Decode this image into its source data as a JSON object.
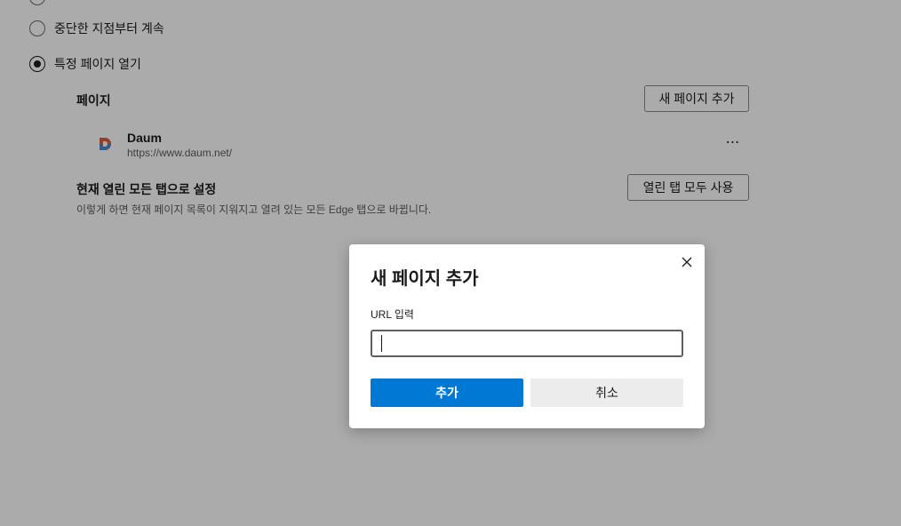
{
  "startup": {
    "options": [
      {
        "label": "중단한 지점부터 계속",
        "checked": false
      },
      {
        "label": "특정 페이지 열기",
        "checked": true
      }
    ],
    "pages_label": "페이지",
    "add_page_button": "새 페이지 추가",
    "sites": [
      {
        "name": "Daum",
        "url": "https://www.daum.net/",
        "icon": "daum-logo-icon",
        "more_label": "⋯"
      }
    ],
    "use_open_tabs": {
      "title": "현재 열린 모든 탭으로 설정",
      "description": "이렇게 하면 현재 페이지 목록이 지워지고 열려 있는 모든 Edge 탭으로 바뀝니다.",
      "button": "열린 탭 모두 사용"
    }
  },
  "dialog": {
    "title": "새 페이지 추가",
    "field_label": "URL 입력",
    "url_value": "",
    "primary_button": "추가",
    "secondary_button": "취소",
    "close_icon": "close-icon"
  },
  "colors": {
    "accent": "#0078d4",
    "overlay": "rgba(0,0,0,0.33)"
  }
}
